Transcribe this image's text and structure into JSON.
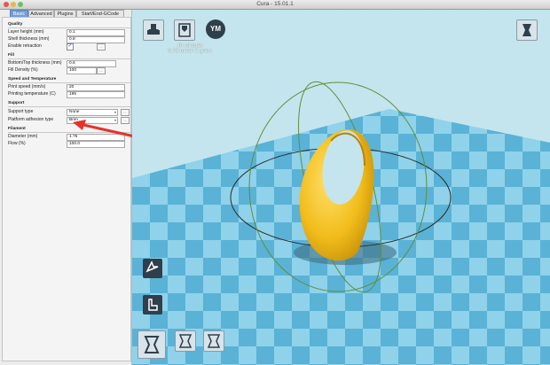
{
  "window": {
    "title": "Cura - 15.01.1"
  },
  "tabs": [
    {
      "label": "Basic",
      "active": true
    },
    {
      "label": "Advanced",
      "active": false
    },
    {
      "label": "Plugins",
      "active": false
    },
    {
      "label": "Start/End-GCode",
      "active": false
    }
  ],
  "sections": {
    "quality": {
      "title": "Quality",
      "layer_height": {
        "label": "Layer height (mm)",
        "value": "0.1"
      },
      "shell_thickness": {
        "label": "Shell thickness (mm)",
        "value": "0.8"
      },
      "enable_retraction": {
        "label": "Enable retraction",
        "checked": true
      }
    },
    "fill": {
      "title": "Fill",
      "bottom_top": {
        "label": "Bottom/Top thickness (mm)",
        "value": "0.6"
      },
      "fill_density": {
        "label": "Fill Density (%)",
        "value": "100"
      }
    },
    "speed": {
      "title": "Speed and Temperature",
      "print_speed": {
        "label": "Print speed (mm/s)",
        "value": "20"
      },
      "printing_temp": {
        "label": "Printing temperature (C)",
        "value": "195"
      }
    },
    "support": {
      "title": "Support",
      "support_type": {
        "label": "Support type",
        "value": "None"
      },
      "platform_adhesion": {
        "label": "Platform adhesion type",
        "value": "Brim"
      }
    },
    "filament": {
      "title": "Filament",
      "diameter": {
        "label": "Diameter (mm)",
        "value": "1.75"
      },
      "flow": {
        "label": "Flow (%)",
        "value": "100.0"
      }
    }
  },
  "buttons": {
    "more": "..."
  },
  "viewport": {
    "print_estimate": [
      "40 minutes",
      "0.73 meter 2 gram"
    ],
    "ym_label": "YM"
  },
  "icons": {
    "traffic_red": "close-dot",
    "traffic_yellow": "minimize-dot",
    "traffic_green": "zoom-dot",
    "load": "load-model-icon",
    "print": "print-icon",
    "youmagine": "youmagine-icon",
    "view_mode": "view-mode-icon",
    "rotate": "rotate-icon",
    "scale": "scale-icon",
    "mirror": "mirror-icon"
  },
  "colors": {
    "accent_tab": "#6f9fd6",
    "model_yellow": "#f2bd1c",
    "bed_light": "#8fd2ea",
    "bed_dark": "#5ab2d6",
    "annotation_arrow": "#e3342b",
    "toolbar_dark": "#2f3f4c"
  }
}
